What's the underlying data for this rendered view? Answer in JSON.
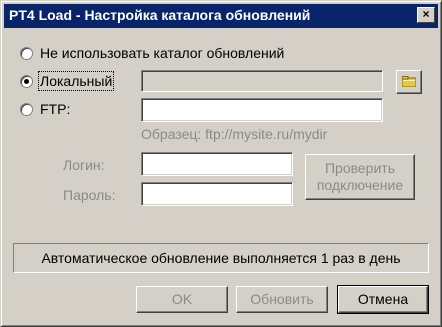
{
  "window": {
    "title": "PT4 Load - Настройка каталога обновлений",
    "close_glyph": "×"
  },
  "options": {
    "no_catalog": "Не использовать каталог обновлений",
    "local": "Локальный",
    "ftp": "FTP:",
    "selected": "local"
  },
  "ftp": {
    "example": "Образец: ftp://mysite.ru/mydir",
    "login_label": "Логин:",
    "password_label": "Пароль:",
    "check_line1": "Проверить",
    "check_line2": "подключение"
  },
  "inputs": {
    "local_path": "",
    "ftp_address": "",
    "login": "",
    "password": ""
  },
  "info": "Автоматическое обновление выполняется 1 раз в день",
  "buttons": {
    "ok": "OK",
    "update": "Обновить",
    "cancel": "Отмена"
  },
  "icons": {
    "browse": "folder-icon",
    "close": "close-icon"
  },
  "colors": {
    "title_bar": "#08246b",
    "face": "#d4d0c8",
    "disabled_text": "#8a8a8a"
  }
}
